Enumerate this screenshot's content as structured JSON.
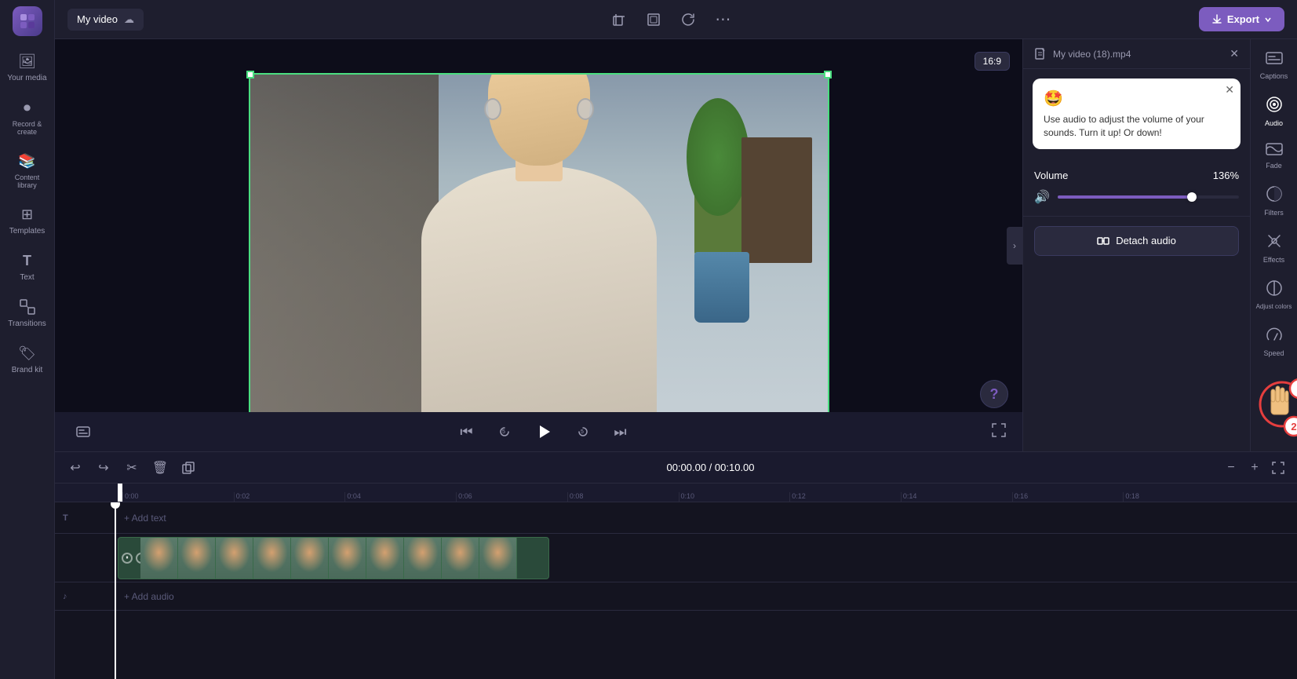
{
  "app": {
    "logo_label": "Clipchamp",
    "project_title": "My video",
    "cloud_icon": "☁"
  },
  "toolbar": {
    "crop_icon": "⊞",
    "resize_icon": "⊡",
    "rotate_icon": "↺",
    "more_icon": "⋯",
    "export_label": "Export"
  },
  "video_area": {
    "aspect_ratio": "16:9",
    "question_label": "?"
  },
  "playback": {
    "skip_back_icon": "⏮",
    "rewind_icon": "↺",
    "play_icon": "▶",
    "forward_icon": "↻",
    "skip_forward_icon": "⏭",
    "captions_icon": "⊡",
    "fullscreen_icon": "⛶"
  },
  "right_panel": {
    "file_name": "My video (18).mp4",
    "tooltip_emoji": "🤩",
    "tooltip_text": "Use audio to adjust the volume of your sounds. Turn it up! Or down!",
    "volume_label": "Volume",
    "volume_value": "136%",
    "volume_percent": 0.74,
    "detach_label": "Detach audio"
  },
  "right_icons": {
    "captions_label": "Captions",
    "audio_label": "Audio",
    "fade_label": "Fade",
    "filters_label": "Filters",
    "effects_label": "Effects",
    "adjust_label": "Adjust colors",
    "speed_label": "Speed"
  },
  "timeline": {
    "time_current": "00:00.00",
    "time_total": "00:10.00",
    "time_display": "00:00.00 / 00:10.00",
    "markers": [
      "0:00",
      "0:02",
      "0:04",
      "0:06",
      "0:08",
      "0:10",
      "0:12",
      "0:14",
      "0:16",
      "0:18"
    ],
    "add_text_label": "+ Add text",
    "add_audio_label": "+ Add audio"
  },
  "sidebar": {
    "items": [
      {
        "id": "your-media",
        "label": "Your media",
        "icon": "🖼"
      },
      {
        "id": "record",
        "label": "Record &\ncreate",
        "icon": "⏺"
      },
      {
        "id": "content-library",
        "label": "Content library",
        "icon": "📚"
      },
      {
        "id": "templates",
        "label": "Templates",
        "icon": "⊞"
      },
      {
        "id": "text",
        "label": "Text",
        "icon": "T"
      },
      {
        "id": "transitions",
        "label": "Transitions",
        "icon": "⊠"
      },
      {
        "id": "brand-kit",
        "label": "Brand kit",
        "icon": "🏷"
      }
    ]
  }
}
